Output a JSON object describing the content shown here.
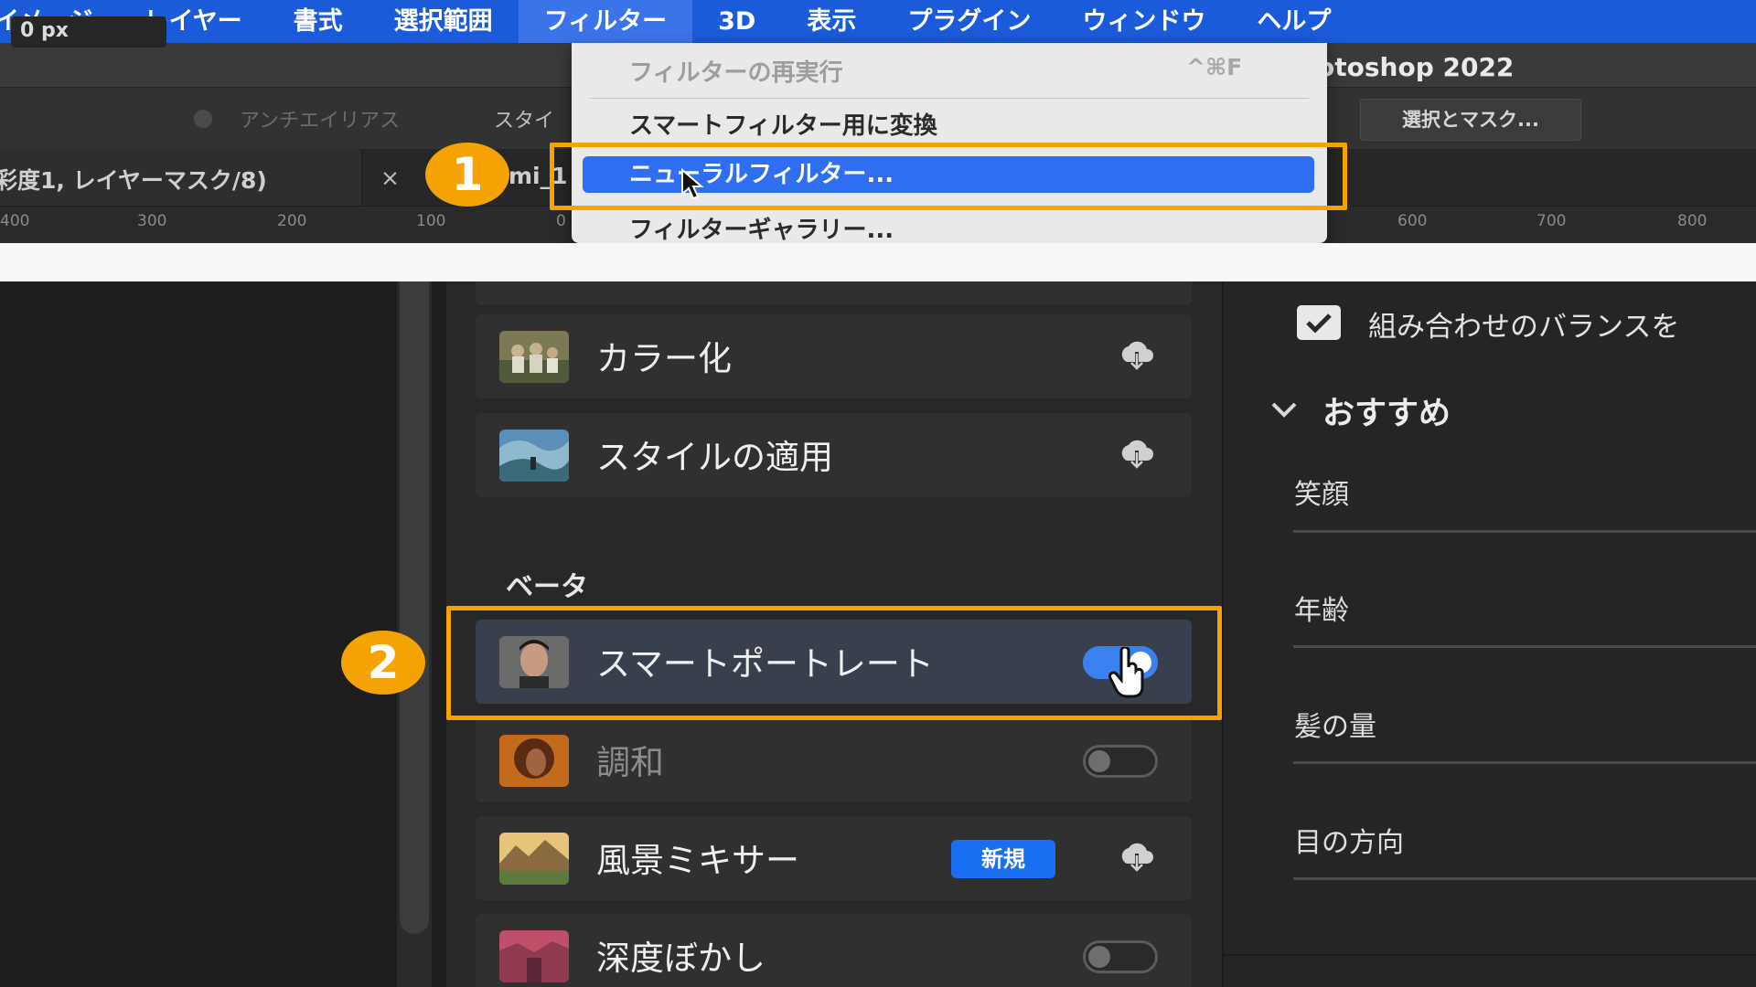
{
  "menubar": {
    "items": [
      "イメージ",
      "レイヤー",
      "書式",
      "選択範囲",
      "フィルター",
      "3D",
      "表示",
      "プラグイン",
      "ウィンドウ",
      "ヘルプ"
    ],
    "active_index": 4
  },
  "titlebar": {
    "app_title": "otoshop 2022"
  },
  "options_bar": {
    "feather_value": "0 px",
    "antialias_label": "アンチエイリアス",
    "style_label": "スタイ",
    "select_mask_button": "選択とマスク..."
  },
  "doc_tabs": {
    "active_label": "彩度1, レイヤーマスク/8)",
    "close_glyph": "×",
    "second_label": "mi_1"
  },
  "ruler": {
    "ticks": [
      "400",
      "300",
      "200",
      "100",
      "0",
      "600",
      "700",
      "800"
    ]
  },
  "filter_menu": {
    "repeat_last": "フィルターの再実行",
    "repeat_shortcut": "^⌘F",
    "convert_smart": "スマートフィルター用に変換",
    "neural_filters": "ニューラルフィルター...",
    "filter_gallery": "フィルターギャラリー..."
  },
  "callouts": {
    "step1": "1",
    "step2": "2"
  },
  "neural_panel": {
    "filters": [
      {
        "label": "カラー化",
        "state": "download"
      },
      {
        "label": "スタイルの適用",
        "state": "download"
      }
    ],
    "beta_header": "ベータ",
    "beta_filters": [
      {
        "label": "スマートポートレート",
        "state": "on"
      },
      {
        "label": "調和",
        "state": "off"
      },
      {
        "label": "風景ミキサー",
        "state": "download",
        "badge": "新規"
      },
      {
        "label": "深度ぼかし",
        "state": "off"
      }
    ]
  },
  "settings_panel": {
    "combo_balance_label": "組み合わせのバランスを",
    "combo_balance_checked": true,
    "recommended_title": "おすすめ",
    "sliders": [
      "笑顔",
      "年齢",
      "髪の量",
      "目の方向"
    ]
  },
  "colors": {
    "menubar_bg": "#1b5ad8",
    "highlight": "#f5a300",
    "toggle_on": "#3b82f0",
    "new_badge": "#1a6ef0"
  },
  "icons": {
    "download": "cloud-download-icon",
    "checkbox": "checkmark-icon",
    "chevron": "chevron-down-icon",
    "cursor": "arrow-cursor-icon",
    "hand": "hand-pointer-icon"
  }
}
